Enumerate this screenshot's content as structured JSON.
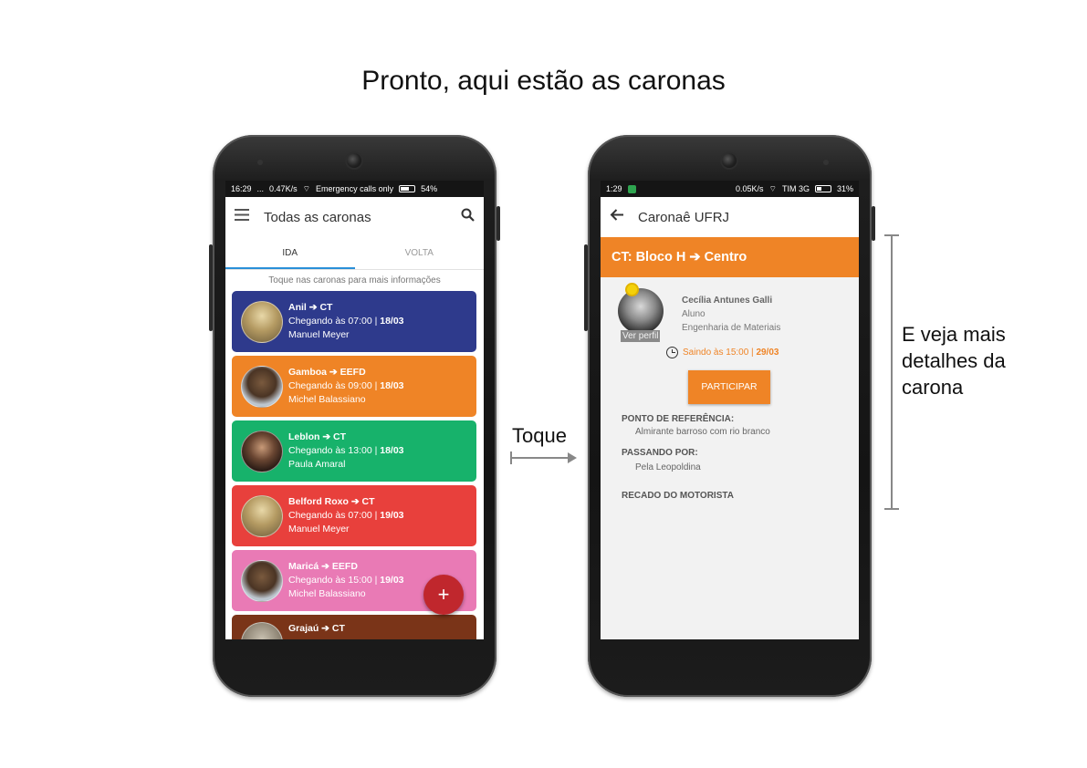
{
  "headline": "Pronto, aqui estão as caronas",
  "annotations": {
    "tap_label": "Toque",
    "detail_note_line1": "E veja mais",
    "detail_note_line2": "detalhes da",
    "detail_note_line3": "carona"
  },
  "left_phone": {
    "status": {
      "time": "16:29",
      "dots": "...",
      "speed": "0.47K/s",
      "signal_text": "Emergency calls only",
      "battery": "54%"
    },
    "app_title": "Todas as caronas",
    "tabs": [
      {
        "label": "IDA",
        "active": true
      },
      {
        "label": "VOLTA",
        "active": false
      }
    ],
    "hint": "Toque nas caronas para mais informações",
    "rides": [
      {
        "route": "Anil ➔ CT",
        "arrival_prefix": "Chegando às 07:00 |",
        "date": "18/03",
        "driver": "Manuel Meyer",
        "color": "#2e3a8c"
      },
      {
        "route": "Gamboa ➔ EEFD",
        "arrival_prefix": "Chegando às 09:00 |",
        "date": "18/03",
        "driver": "Michel Balassiano",
        "color": "#ef8426"
      },
      {
        "route": "Leblon ➔ CT",
        "arrival_prefix": "Chegando às 13:00 |",
        "date": "18/03",
        "driver": "Paula Amaral",
        "color": "#17b26b"
      },
      {
        "route": "Belford Roxo ➔ CT",
        "arrival_prefix": "Chegando às 07:00 |",
        "date": "19/03",
        "driver": "Manuel Meyer",
        "color": "#e8403c"
      },
      {
        "route": "Maricá ➔ EEFD",
        "arrival_prefix": "Chegando às 15:00 |",
        "date": "19/03",
        "driver": "Michel Balassiano",
        "color": "#e97ab5"
      },
      {
        "route": "Grajaú ➔ CT",
        "arrival_prefix": "",
        "date": "",
        "driver": "",
        "color": "#7a3418"
      }
    ],
    "fab_label": "+"
  },
  "right_phone": {
    "status": {
      "time": "1:29",
      "speed": "0.05K/s",
      "carrier": "TIM 3G",
      "battery": "31%"
    },
    "app_title": "Caronaê UFRJ",
    "ride_title": "CT: Bloco H ➔ Centro",
    "driver": {
      "name": "Cecília Antunes Galli",
      "role": "Aluno",
      "course": "Engenharia de Materiais",
      "profile_link": "Ver perfil"
    },
    "departure_prefix": "Saindo às 15:00 |",
    "departure_date": "29/03",
    "join_button": "PARTICIPAR",
    "reference_label": "PONTO DE REFERÊNCIA:",
    "reference_value": "Almirante barroso com rio branco",
    "passing_label": "PASSANDO POR:",
    "passing_value": "Pela Leopoldina",
    "driver_note_label": "RECADO DO MOTORISTA"
  },
  "colors": {
    "accent_orange": "#ef8426",
    "tab_indicator": "#2a8fd8",
    "fab": "#c0272d"
  }
}
